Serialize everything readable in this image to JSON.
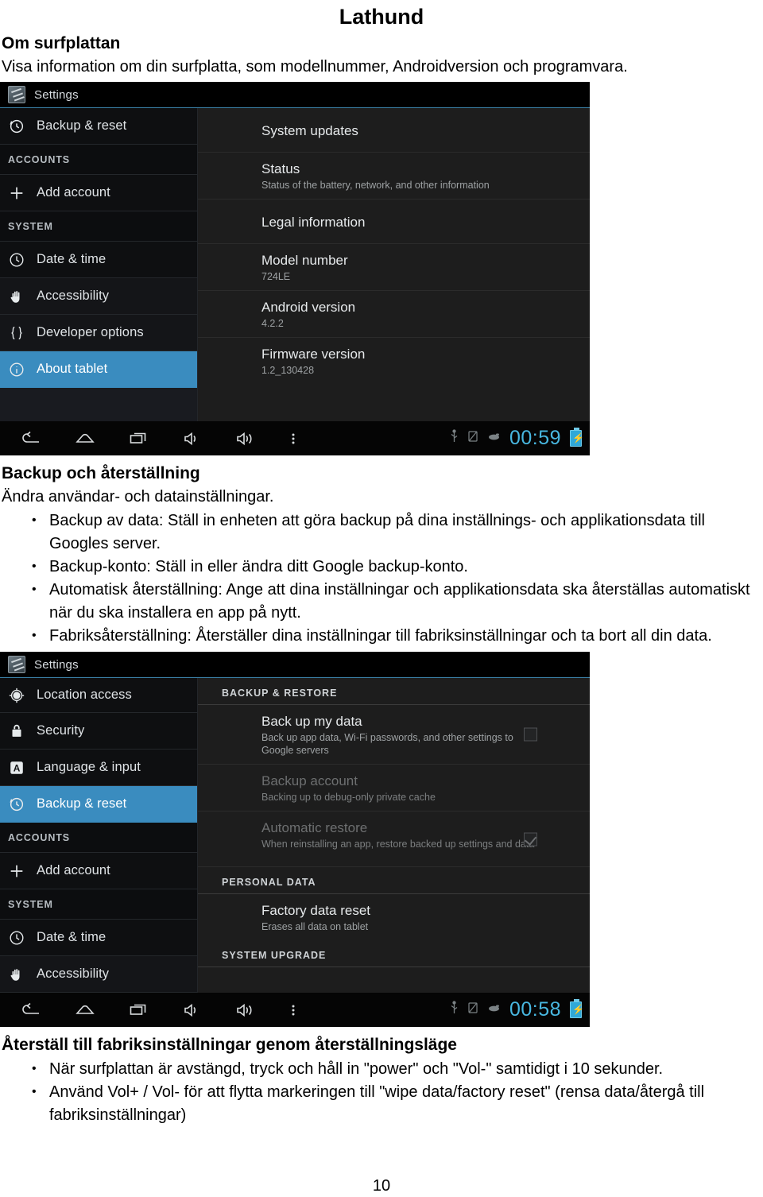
{
  "document": {
    "title": "Lathund",
    "page_number": "10",
    "sections": [
      {
        "heading": "Om surfplattan",
        "intro": "Visa information om din surfplatta, som modellnummer, Androidversion och programvara.",
        "bullets": []
      },
      {
        "heading": "Backup och återställning",
        "intro": "Ändra användar- och datainställningar.",
        "bullets": [
          "Backup av data: Ställ in enheten att göra backup på dina inställnings- och applikationsdata till Googles server.",
          "Backup-konto: Ställ in eller ändra ditt Google backup-konto.",
          "Automatisk återställning: Ange att dina inställningar och applikationsdata ska återställas automatiskt när du ska installera en app på nytt.",
          "Fabriksåterställning: Återställer dina inställningar till fabriksinställningar och ta bort all din data."
        ]
      },
      {
        "heading": "Återställ till fabriksinställningar genom återställningsläge",
        "intro": "",
        "bullets": [
          "När surfplattan är avstängd, tryck och håll in \"power\" och \"Vol-\" samtidigt i 10 sekunder.",
          "Använd Vol+ / Vol- för att flytta markeringen till \"wipe data/factory reset\" (rensa data/återgå till fabriksinställningar)"
        ]
      }
    ]
  },
  "screenshot_about": {
    "topbar": {
      "app_title": "Settings",
      "icon": "settings-icon"
    },
    "sidebar": [
      {
        "type": "item",
        "label": "Backup & reset",
        "icon": "backup-reset-icon",
        "selected": false
      },
      {
        "type": "header",
        "label": "ACCOUNTS"
      },
      {
        "type": "item",
        "label": "Add account",
        "icon": "plus-icon",
        "selected": false
      },
      {
        "type": "header",
        "label": "SYSTEM"
      },
      {
        "type": "item",
        "label": "Date & time",
        "icon": "clock-icon",
        "selected": false
      },
      {
        "type": "item",
        "label": "Accessibility",
        "icon": "hand-icon",
        "selected": false
      },
      {
        "type": "item",
        "label": "Developer options",
        "icon": "braces-icon",
        "selected": false
      },
      {
        "type": "item",
        "label": "About tablet",
        "icon": "info-icon",
        "selected": true
      }
    ],
    "content": [
      {
        "type": "row",
        "title": "System updates",
        "sub": ""
      },
      {
        "type": "row",
        "title": "Status",
        "sub": "Status of the battery, network, and other information"
      },
      {
        "type": "row",
        "title": "Legal information",
        "sub": ""
      },
      {
        "type": "row",
        "title": "Model number",
        "sub": "724LE"
      },
      {
        "type": "row",
        "title": "Android version",
        "sub": "4.2.2"
      },
      {
        "type": "row",
        "title": "Firmware version",
        "sub": "1.2_130428"
      }
    ],
    "navbar": {
      "buttons": [
        "back-icon",
        "home-icon",
        "recents-icon",
        "volume-down-icon",
        "volume-up-icon",
        "overflow-menu-icon"
      ],
      "status_icons": [
        "usb-icon",
        "sd-card-icon",
        "mouse-icon"
      ],
      "clock": "00:59",
      "battery": "battery-charging-icon"
    }
  },
  "screenshot_backup": {
    "topbar": {
      "app_title": "Settings",
      "icon": "settings-icon"
    },
    "sidebar": [
      {
        "type": "item",
        "label": "Location access",
        "icon": "location-icon",
        "selected": false
      },
      {
        "type": "item",
        "label": "Security",
        "icon": "lock-icon",
        "selected": false
      },
      {
        "type": "item",
        "label": "Language & input",
        "icon": "language-icon",
        "selected": false
      },
      {
        "type": "item",
        "label": "Backup & reset",
        "icon": "backup-reset-icon",
        "selected": true
      },
      {
        "type": "header",
        "label": "ACCOUNTS"
      },
      {
        "type": "item",
        "label": "Add account",
        "icon": "plus-icon",
        "selected": false
      },
      {
        "type": "header",
        "label": "SYSTEM"
      },
      {
        "type": "item",
        "label": "Date & time",
        "icon": "clock-icon",
        "selected": false
      },
      {
        "type": "item",
        "label": "Accessibility",
        "icon": "hand-icon",
        "selected": false
      }
    ],
    "content": [
      {
        "type": "section",
        "label": "BACKUP & RESTORE"
      },
      {
        "type": "row",
        "title": "Back up my data",
        "sub": "Back up app data, Wi-Fi passwords, and other settings to Google servers",
        "dim": false,
        "checkbox": "unchecked"
      },
      {
        "type": "row",
        "title": "Backup account",
        "sub": "Backing up to debug-only private cache",
        "dim": true,
        "checkbox": "none"
      },
      {
        "type": "row",
        "title": "Automatic restore",
        "sub": "When reinstalling an app, restore backed up settings and data",
        "dim": true,
        "checkbox": "checked"
      },
      {
        "type": "section",
        "label": "PERSONAL DATA"
      },
      {
        "type": "row",
        "title": "Factory data reset",
        "sub": "Erases all data on tablet",
        "dim": false,
        "checkbox": "none"
      },
      {
        "type": "section",
        "label": "SYSTEM UPGRADE"
      }
    ],
    "navbar": {
      "buttons": [
        "back-icon",
        "home-icon",
        "recents-icon",
        "volume-down-icon",
        "volume-up-icon",
        "overflow-menu-icon"
      ],
      "status_icons": [
        "usb-icon",
        "sd-card-icon",
        "mouse-icon"
      ],
      "clock": "00:58",
      "battery": "battery-charging-icon"
    }
  },
  "colors": {
    "selection_blue": "#3a8cbf",
    "clock_blue": "#48b7e0",
    "screenshot_bg": "#1d1d1d",
    "sidebar_bg": "#0e0f11"
  }
}
